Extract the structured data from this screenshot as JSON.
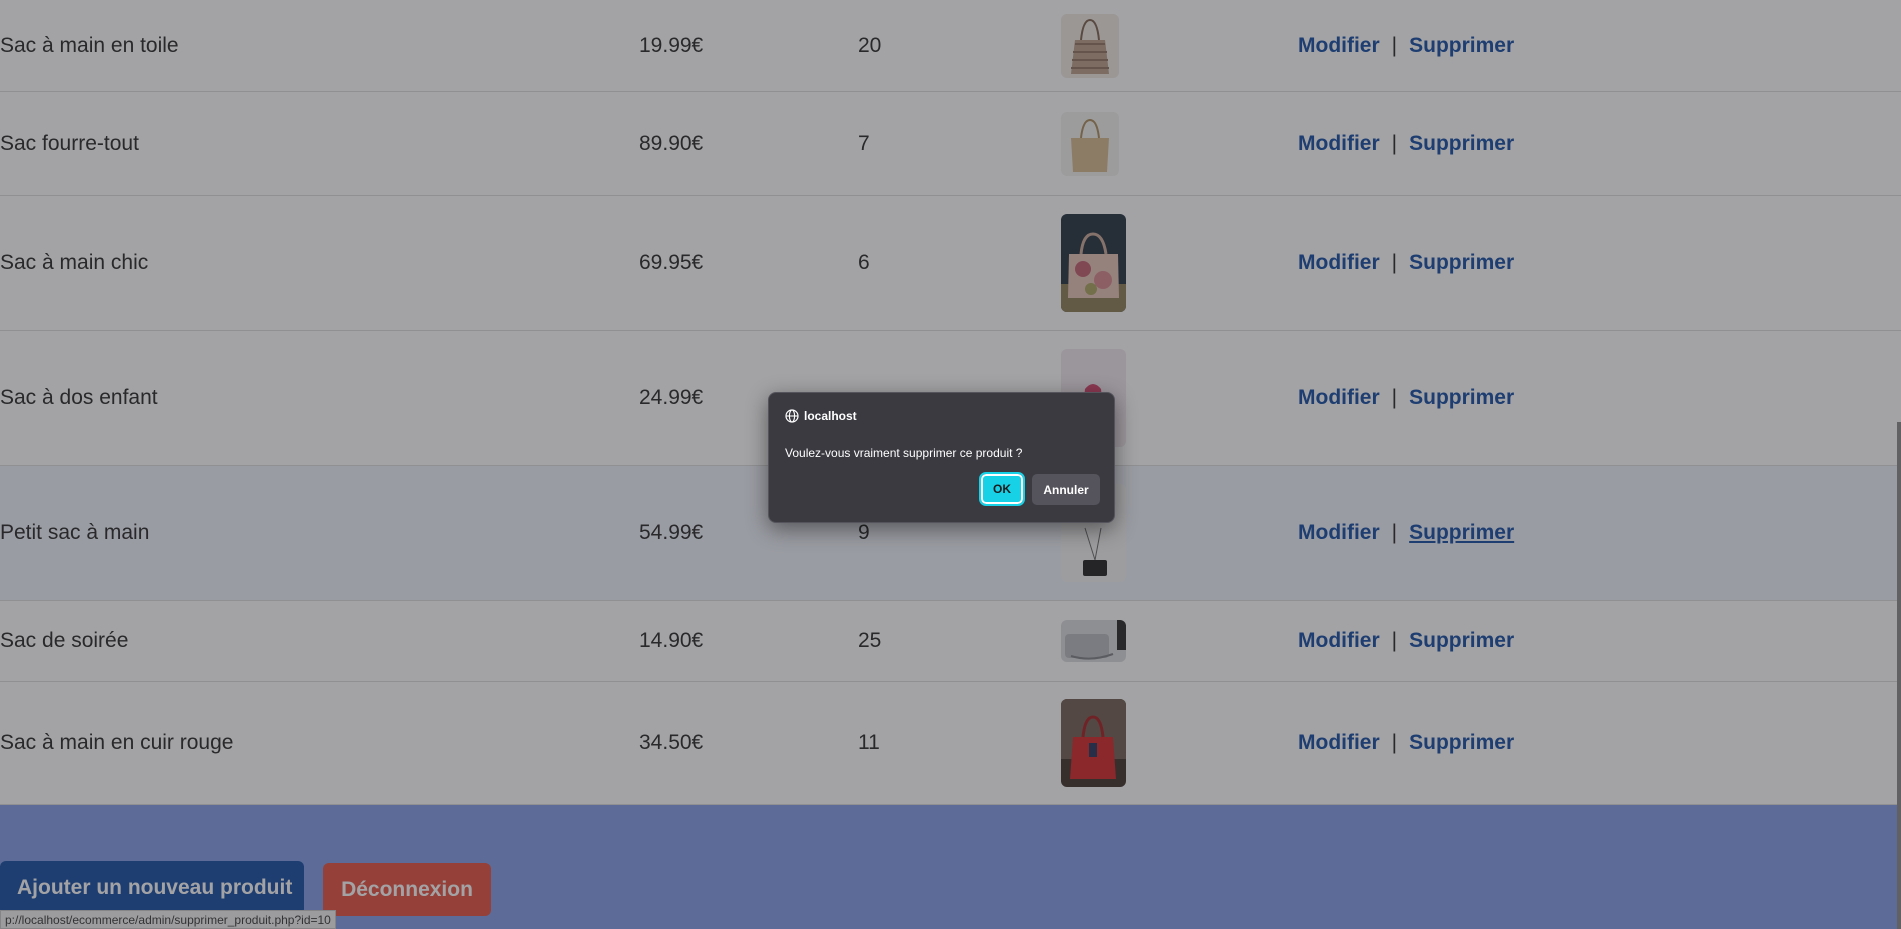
{
  "table": {
    "rows": [
      {
        "name": "Sac à main en toile",
        "price": "19.99€",
        "qty": "20",
        "image": "canvas-tote-bag",
        "modify": "Modifier",
        "separator": "|",
        "delete": "Supprimer"
      },
      {
        "name": "Sac fourre-tout",
        "price": "89.90€",
        "qty": "7",
        "image": "beige-tote-bag",
        "modify": "Modifier",
        "separator": "|",
        "delete": "Supprimer"
      },
      {
        "name": "Sac à main chic",
        "price": "69.95€",
        "qty": "6",
        "image": "floral-handbag",
        "modify": "Modifier",
        "separator": "|",
        "delete": "Supprimer"
      },
      {
        "name": "Sac à dos enfant",
        "price": "24.99€",
        "qty": "",
        "image": "pink-backpack",
        "modify": "Modifier",
        "separator": "|",
        "delete": "Supprimer"
      },
      {
        "name": "Petit sac à main",
        "price": "54.99€",
        "qty": "9",
        "image": "small-black-bag",
        "modify": "Modifier",
        "separator": "|",
        "delete": "Supprimer"
      },
      {
        "name": "Sac de soirée",
        "price": "14.90€",
        "qty": "25",
        "image": "silver-evening-bag",
        "modify": "Modifier",
        "separator": "|",
        "delete": "Supprimer"
      },
      {
        "name": "Sac à main en cuir rouge",
        "price": "34.50€",
        "qty": "11",
        "image": "red-leather-bag",
        "modify": "Modifier",
        "separator": "|",
        "delete": "Supprimer"
      }
    ]
  },
  "actions": {
    "add_label": "Ajouter un nouveau produit",
    "logout_label": "Déconnexion"
  },
  "status_bar": {
    "url": "p://localhost/ecommerce/admin/supprimer_produit.php?id=10"
  },
  "dialog": {
    "origin": "localhost",
    "message": "Voulez-vous vraiment supprimer ce produit ?",
    "ok_label": "OK",
    "cancel_label": "Annuler"
  },
  "colors": {
    "link": "#0d47a1",
    "danger": "#e74c3c",
    "accent": "#17d1e6",
    "dialog_bg": "#3b3a41"
  }
}
